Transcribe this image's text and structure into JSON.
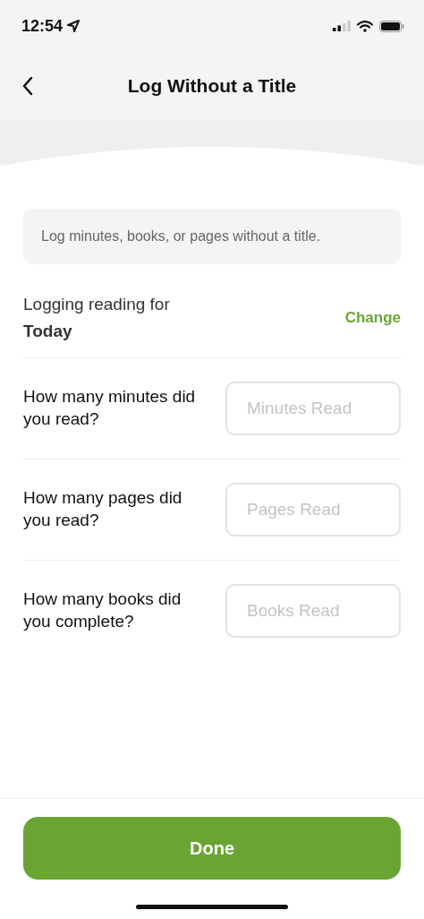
{
  "status_bar": {
    "time": "12:54"
  },
  "header": {
    "title": "Log Without a Title"
  },
  "info": {
    "text": "Log minutes, books, or pages without a title."
  },
  "logging": {
    "label": "Logging reading for",
    "date": "Today",
    "action": "Change"
  },
  "questions": [
    {
      "label": "How many minutes did you read?",
      "placeholder": "Minutes Read"
    },
    {
      "label": "How many pages did you read?",
      "placeholder": "Pages Read"
    },
    {
      "label": "How many books did you complete?",
      "placeholder": "Books Read"
    }
  ],
  "done_button": {
    "label": "Done"
  }
}
